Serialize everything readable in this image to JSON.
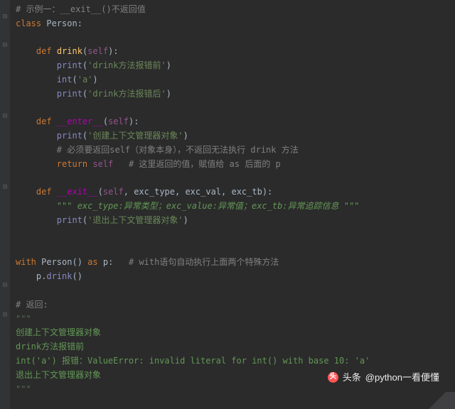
{
  "gutter": {
    "folds": [
      20,
      60,
      160,
      260,
      398,
      440
    ]
  },
  "code": {
    "lines": [
      [
        [
          "c-comment",
          "# 示例一：__exit__()不返回值"
        ]
      ],
      [
        [
          "c-keyword",
          "class "
        ],
        [
          "c-param",
          "Person"
        ],
        [
          "c-param",
          ":"
        ]
      ],
      [],
      [
        [
          "c-param",
          "    "
        ],
        [
          "c-keyword",
          "def "
        ],
        [
          "c-deffunc",
          "drink"
        ],
        [
          "c-param",
          "("
        ],
        [
          "c-self",
          "self"
        ],
        [
          "c-param",
          "):"
        ]
      ],
      [
        [
          "c-param",
          "        "
        ],
        [
          "c-builtin",
          "print"
        ],
        [
          "c-param",
          "("
        ],
        [
          "c-string",
          "'drink方法报错前'"
        ],
        [
          "c-param",
          ")"
        ]
      ],
      [
        [
          "c-param",
          "        "
        ],
        [
          "c-builtin",
          "int"
        ],
        [
          "c-param",
          "("
        ],
        [
          "c-string",
          "'a'"
        ],
        [
          "c-param",
          ")"
        ]
      ],
      [
        [
          "c-param",
          "        "
        ],
        [
          "c-builtin",
          "print"
        ],
        [
          "c-param",
          "("
        ],
        [
          "c-string",
          "'drink方法报错后'"
        ],
        [
          "c-param",
          ")"
        ]
      ],
      [],
      [
        [
          "c-param",
          "    "
        ],
        [
          "c-keyword",
          "def "
        ],
        [
          "c-dunder",
          "__enter__"
        ],
        [
          "c-param",
          "("
        ],
        [
          "c-self",
          "self"
        ],
        [
          "c-param",
          "):"
        ]
      ],
      [
        [
          "c-param",
          "        "
        ],
        [
          "c-builtin",
          "print"
        ],
        [
          "c-param",
          "("
        ],
        [
          "c-string",
          "'创建上下文管理器对象'"
        ],
        [
          "c-param",
          ")"
        ]
      ],
      [
        [
          "c-param",
          "        "
        ],
        [
          "c-comment",
          "# 必须要返回self（对象本身），不返回无法执行 drink 方法"
        ]
      ],
      [
        [
          "c-param",
          "        "
        ],
        [
          "c-keyword",
          "return "
        ],
        [
          "c-self",
          "self"
        ],
        [
          "c-param",
          "   "
        ],
        [
          "c-comment",
          "# 这里返回的值，赋值给 as 后面的 p"
        ]
      ],
      [],
      [
        [
          "c-param",
          "    "
        ],
        [
          "c-keyword",
          "def "
        ],
        [
          "c-dunder",
          "__exit__"
        ],
        [
          "c-param",
          "("
        ],
        [
          "c-self",
          "self"
        ],
        [
          "c-param",
          ", exc_type, exc_val, exc_tb):"
        ]
      ],
      [
        [
          "c-param",
          "        "
        ],
        [
          "c-docstr",
          "\"\"\" exc_type:异常类型；exc_value:异常值；exc_tb:异常追踪信息 \"\"\""
        ]
      ],
      [
        [
          "c-param",
          "        "
        ],
        [
          "c-builtin",
          "print"
        ],
        [
          "c-param",
          "("
        ],
        [
          "c-string",
          "'退出上下文管理器对象'"
        ],
        [
          "c-param",
          ")"
        ]
      ],
      [],
      [],
      [
        [
          "c-keyword",
          "with "
        ],
        [
          "c-param",
          "Person() "
        ],
        [
          "c-keyword",
          "as "
        ],
        [
          "c-param",
          "p:   "
        ],
        [
          "c-comment",
          "# with语句自动执行上面两个特殊方法"
        ]
      ],
      [
        [
          "c-param",
          "    p."
        ],
        [
          "c-call",
          "drink"
        ],
        [
          "c-param",
          "()"
        ]
      ],
      [],
      [
        [
          "c-comment",
          "# 返回:"
        ]
      ],
      [
        [
          "c-outfaint",
          "\"\"\""
        ]
      ],
      [
        [
          "c-out",
          "创建上下文管理器对象"
        ]
      ],
      [
        [
          "c-out",
          "drink方法报错前"
        ]
      ],
      [
        [
          "c-out",
          "int('a') 报错：ValueError: invalid literal for int() with base 10: 'a'"
        ]
      ],
      [
        [
          "c-out",
          "退出上下文管理器对象"
        ]
      ],
      [
        [
          "c-outfaint",
          "\"\"\""
        ]
      ]
    ]
  },
  "watermark": {
    "prefix": "头条",
    "handle": "@python一看便懂"
  }
}
